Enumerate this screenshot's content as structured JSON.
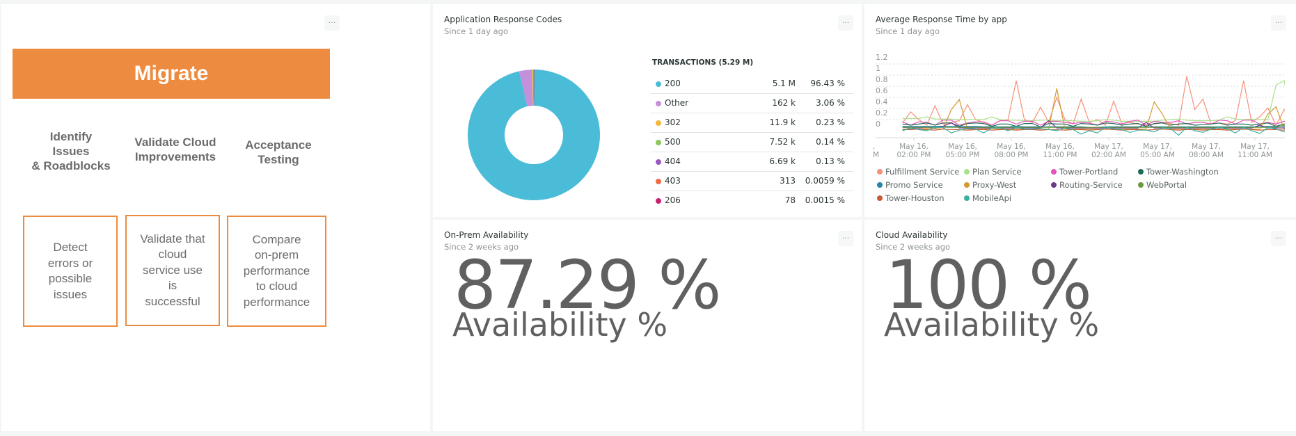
{
  "migrate_widget": {
    "banner": "Migrate",
    "columns": [
      {
        "heading": [
          "Identify",
          "Issues",
          "& Roadblocks"
        ],
        "box": [
          "Detect",
          "errors or",
          "possible",
          "issues"
        ]
      },
      {
        "heading": [
          "Validate Cloud",
          "Improvements"
        ],
        "box": [
          "Validate that",
          "cloud",
          "service use",
          "is",
          "successful"
        ]
      },
      {
        "heading": [
          "Acceptance",
          "Testing"
        ],
        "box": [
          "Compare",
          "on-prem",
          "performance",
          "to cloud",
          "performance"
        ]
      }
    ],
    "menu": "..."
  },
  "response_codes": {
    "title": "Application Response Codes",
    "subtitle": "Since 1 day ago",
    "menu": "...",
    "table_header": "TRANSACTIONS (5.29 M)",
    "rows": [
      {
        "label": "200",
        "count": "5.1 M",
        "pct": "96.43 %",
        "color": "#4bbcd8"
      },
      {
        "label": "Other",
        "count": "162 k",
        "pct": "3.06 %",
        "color": "#c48fdb"
      },
      {
        "label": "302",
        "count": "11.9 k",
        "pct": "0.23 %",
        "color": "#f5b83c"
      },
      {
        "label": "500",
        "count": "7.52 k",
        "pct": "0.14 %",
        "color": "#8bc75a"
      },
      {
        "label": "404",
        "count": "6.69 k",
        "pct": "0.13 %",
        "color": "#9b59c0"
      },
      {
        "label": "403",
        "count": "313",
        "pct": "0.0059 %",
        "color": "#f06a44"
      },
      {
        "label": "206",
        "count": "78",
        "pct": "0.0015 %",
        "color": "#c8206f"
      }
    ]
  },
  "response_time": {
    "title": "Average Response Time by app",
    "subtitle": "Since 1 day ago",
    "menu": "...",
    "legend": [
      {
        "name": "Fulfillment Service",
        "color": "#f7907a"
      },
      {
        "name": "Plan Service",
        "color": "#a9e08a"
      },
      {
        "name": "Tower-Portland",
        "color": "#e553b8"
      },
      {
        "name": "Tower-Washington",
        "color": "#1c6b5a"
      },
      {
        "name": "Promo Service",
        "color": "#2485a6"
      },
      {
        "name": "Proxy-West",
        "color": "#d49a32"
      },
      {
        "name": "Routing-Service",
        "color": "#6b3a8c"
      },
      {
        "name": "WebPortal",
        "color": "#6a9a3e"
      },
      {
        "name": "Tower-Houston",
        "color": "#c85a36"
      },
      {
        "name": "MobileApi",
        "color": "#3ab1a0"
      }
    ]
  },
  "onprem": {
    "title": "On-Prem Availability",
    "subtitle": "Since 2 weeks ago",
    "menu": "...",
    "value": "87.29 %",
    "label": "Availability %"
  },
  "cloud": {
    "title": "Cloud Availability",
    "subtitle": "Since 2 weeks ago",
    "menu": "...",
    "value": "100 %",
    "label": "Availability %"
  },
  "chart_data": [
    {
      "type": "pie",
      "title": "Application Response Codes",
      "subtitle": "Since 1 day ago",
      "donut": true,
      "categories": [
        "200",
        "Other",
        "302",
        "500",
        "404",
        "403",
        "206"
      ],
      "values": [
        96.43,
        3.06,
        0.23,
        0.14,
        0.13,
        0.0059,
        0.0015
      ],
      "counts": [
        "5.1 M",
        "162 k",
        "11.9 k",
        "7.52 k",
        "6.69 k",
        "313",
        "78"
      ],
      "colors": [
        "#4bbcd8",
        "#c48fdb",
        "#f5b83c",
        "#8bc75a",
        "#9b59c0",
        "#f06a44",
        "#c8206f"
      ],
      "legend": "right"
    },
    {
      "type": "line",
      "title": "Average Response Time by app",
      "subtitle": "Since 1 day ago",
      "xlabel": "",
      "ylabel": "",
      "ylim": [
        0,
        1.2
      ],
      "yticks": [
        "0",
        "0.2",
        "0.4",
        "0.6",
        "0.8",
        "1",
        "1.2"
      ],
      "xticks": [
        "May 16, 02:00 PM",
        "May 16, 05:00 PM",
        "May 16, 08:00 PM",
        "May 16, 11:00 PM",
        "May 17, 02:00 AM",
        "May 17, 05:00 AM",
        "May 17, 08:00 AM",
        "May 17, 11:00 AM"
      ],
      "x_start_hours": 1.3,
      "x_step_hours": 0.5,
      "x_tick_hours": [
        2,
        5,
        8,
        11,
        14,
        17,
        20,
        23
      ],
      "grid": true,
      "legend": "bottom",
      "series": [
        {
          "name": "Fulfillment Service",
          "values": [
            0.14,
            0.34,
            0.2,
            0.1,
            0.45,
            0.12,
            0.15,
            0.18,
            0.47,
            0.2,
            0.15,
            0.1,
            0.18,
            0.2,
            0.9,
            0.2,
            0.15,
            0.42,
            0.15,
            0.6,
            0.2,
            0.12,
            0.57,
            0.15,
            0.2,
            0.1,
            0.53,
            0.13,
            0.15,
            0.12,
            0.1,
            0.12,
            0.15,
            0.13,
            0.1,
            0.98,
            0.38,
            0.57,
            0.12,
            0.14,
            0.12,
            0.18,
            0.9,
            0.15,
            0.25,
            0.41,
            0.1,
            0.38,
            0.15,
            0.12
          ]
        },
        {
          "name": "Plan Service",
          "values": [
            0.22,
            0.22,
            0.22,
            0.25,
            0.21,
            0.21,
            0.21,
            0.2,
            0.2,
            0.2,
            0.2,
            0.25,
            0.2,
            0.19,
            0.19,
            0.18,
            0.18,
            0.19,
            0.19,
            0.18,
            0.18,
            0.18,
            0.17,
            0.17,
            0.18,
            0.2,
            0.19,
            0.17,
            0.17,
            0.17,
            0.17,
            0.17,
            0.19,
            0.2,
            0.21,
            0.19,
            0.18,
            0.18,
            0.18,
            0.19,
            0.25,
            0.21,
            0.2,
            0.21,
            0.2,
            0.2,
            0.82,
            0.9,
            0.21,
            0.21
          ]
        },
        {
          "name": "Tower-Portland",
          "values": [
            0.16,
            0.1,
            0.16,
            0.15,
            0.1,
            0.19,
            0.19,
            0.1,
            0.14,
            0.16,
            0.16,
            0.1,
            0.18,
            0.18,
            0.12,
            0.17,
            0.17,
            0.1,
            0.17,
            0.17,
            0.15,
            0.13,
            0.15,
            0.14,
            0.1,
            0.17,
            0.16,
            0.12,
            0.17,
            0.19,
            0.1,
            0.17,
            0.15,
            0.15,
            0.18,
            0.12,
            0.15,
            0.15,
            0.12,
            0.19,
            0.18,
            0.12,
            0.19,
            0.19,
            0.12,
            0.15,
            0.12,
            0.17,
            0.17,
            0.18
          ]
        },
        {
          "name": "Tower-Washington",
          "values": [
            0.12,
            0.1,
            0.12,
            0.14,
            0.1,
            0.14,
            0.14,
            0.08,
            0.13,
            0.14,
            0.13,
            0.08,
            0.12,
            0.12,
            0.08,
            0.13,
            0.13,
            0.07,
            0.13,
            0.12,
            0.12,
            0.08,
            0.13,
            0.12,
            0.1,
            0.14,
            0.13,
            0.1,
            0.12,
            0.13,
            0.08,
            0.13,
            0.14,
            0.1,
            0.12,
            0.13,
            0.1,
            0.11,
            0.12,
            0.14,
            0.1,
            0.12,
            0.12,
            0.1,
            0.12,
            0.14,
            0.08,
            0.12,
            0.13,
            0.1
          ]
        },
        {
          "name": "Promo Service",
          "values": [
            0.08,
            0.08,
            0.08,
            0.08,
            0.08,
            0.08,
            0.08,
            0.07,
            0.08,
            0.08,
            0.07,
            0.07,
            0.07,
            0.07,
            0.08,
            0.07,
            0.07,
            0.07,
            0.07,
            0.07,
            0.07,
            0.07,
            0.07,
            0.06,
            0.06,
            0.07,
            0.07,
            0.07,
            0.07,
            0.07,
            0.07,
            0.07,
            0.07,
            0.07,
            0.07,
            0.07,
            0.07,
            0.07,
            0.07,
            0.07,
            0.07,
            0.07,
            0.07,
            0.07,
            0.07,
            0.08,
            0.08,
            0.08,
            0.08,
            0.08
          ]
        },
        {
          "name": "Proxy-West",
          "values": [
            0.03,
            0.03,
            0.03,
            0.04,
            0.04,
            0.03,
            0.38,
            0.56,
            0.03,
            0.03,
            0.03,
            0.04,
            0.03,
            0.03,
            0.03,
            0.03,
            0.03,
            0.03,
            0.03,
            0.76,
            0.03,
            0.03,
            0.03,
            0.03,
            0.03,
            0.03,
            0.03,
            0.03,
            0.03,
            0.03,
            0.03,
            0.52,
            0.3,
            0.03,
            0.03,
            0.03,
            0.03,
            0.03,
            0.03,
            0.03,
            0.03,
            0.03,
            0.03,
            0.03,
            0.03,
            0.3,
            0.43,
            0.03,
            0.03,
            0.03
          ]
        },
        {
          "name": "Routing-Service",
          "values": [
            0.06,
            0.05,
            0.05,
            0.06,
            0.05,
            0.08,
            0.14,
            0.05,
            0.05,
            0.05,
            0.05,
            0.05,
            0.05,
            0.05,
            0.05,
            0.05,
            0.05,
            0.05,
            0.18,
            0.05,
            0.05,
            0.05,
            0.05,
            0.05,
            0.05,
            0.05,
            0.05,
            0.05,
            0.05,
            0.05,
            0.15,
            0.05,
            0.05,
            0.05,
            0.05,
            0.05,
            0.05,
            0.05,
            0.05,
            0.05,
            0.05,
            0.05,
            0.05,
            0.05,
            0.1,
            0.05,
            0.05,
            0.05,
            0.05,
            0.05
          ]
        },
        {
          "name": "WebPortal",
          "values": [
            0.06,
            0.06,
            0.06,
            0.06,
            0.06,
            0.06,
            0.06,
            0.06,
            0.06,
            0.06,
            0.06,
            0.06,
            0.06,
            0.06,
            0.06,
            0.06,
            0.06,
            0.06,
            0.06,
            0.06,
            0.06,
            0.06,
            0.06,
            0.06,
            0.06,
            0.06,
            0.06,
            0.06,
            0.06,
            0.06,
            0.06,
            0.06,
            0.06,
            0.06,
            0.06,
            0.06,
            0.06,
            0.06,
            0.06,
            0.06,
            0.06,
            0.06,
            0.06,
            0.06,
            0.06,
            0.06,
            0.06,
            0.1,
            0.06,
            0.06
          ]
        },
        {
          "name": "Tower-Houston",
          "values": [
            0.02,
            0.02,
            0.03,
            0.02,
            0.01,
            0.03,
            0.02,
            0.02,
            0.01,
            0.02,
            0.02,
            0.01,
            0.02,
            0.02,
            0.01,
            0.02,
            0.02,
            0.01,
            0.02,
            0.02,
            0.01,
            0.02,
            0.02,
            0.01,
            0.02,
            0.03,
            0.02,
            0.01,
            0.02,
            0.02,
            0.01,
            0.02,
            0.03,
            0.02,
            0.01,
            0.02,
            0.02,
            0.01,
            0.02,
            0.02,
            0.01,
            0.02,
            0.03,
            0.02,
            0.01,
            0.02,
            0.02,
            0.01,
            0.02,
            0.02
          ]
        },
        {
          "name": "MobileApi",
          "values": [
            0.0,
            0.05,
            0.02,
            0.0,
            0.06,
            0.06,
            -0.04,
            0.01,
            0.04,
            0.03,
            -0.04,
            0.05,
            0.05,
            0.0,
            0.06,
            0.03,
            0.03,
            0.04,
            0.02,
            0.0,
            0.05,
            0.02,
            -0.06,
            0.0,
            -0.04,
            0.07,
            0.03,
            0.02,
            -0.03,
            0.01,
            0.01,
            -0.02,
            0.05,
            0.04,
            -0.08,
            0.06,
            0.0,
            -0.03,
            0.03,
            0.06,
            0.03,
            -0.04,
            0.06,
            0.0,
            -0.05,
            0.06,
            0.03,
            -0.02,
            -0.05,
            -0.05
          ]
        }
      ]
    }
  ]
}
